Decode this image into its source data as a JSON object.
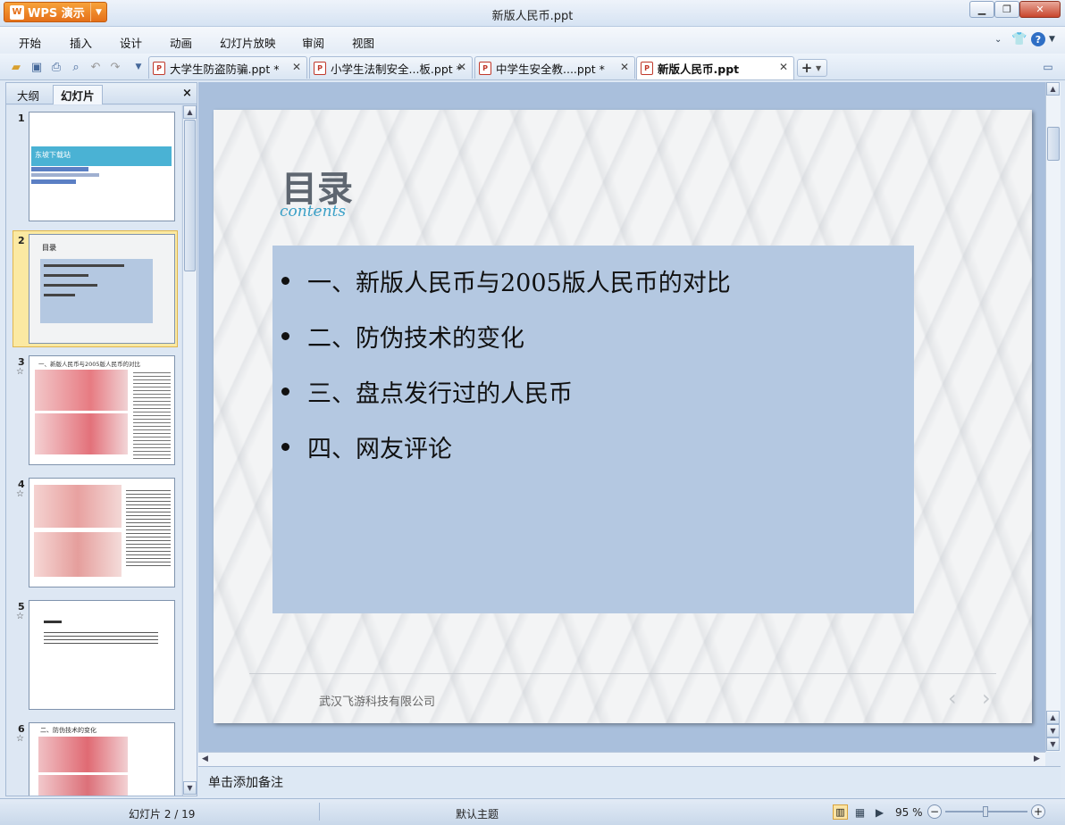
{
  "app": {
    "name": "WPS 演示",
    "window_title": "新版人民币.ppt"
  },
  "menu": [
    "开始",
    "插入",
    "设计",
    "动画",
    "幻灯片放映",
    "审阅",
    "视图"
  ],
  "tabs": [
    {
      "label": "大学生防盗防骗.ppt *",
      "active": false
    },
    {
      "label": "小学生法制安全...板.ppt *",
      "active": false
    },
    {
      "label": "中学生安全教....ppt *",
      "active": false
    },
    {
      "label": "新版人民币.ppt",
      "active": true
    }
  ],
  "panel": {
    "tab_outline": "大纲",
    "tab_slides": "幻灯片",
    "close": "×"
  },
  "thumbnails": [
    {
      "num": "1",
      "text": "东坡下载站",
      "star": ""
    },
    {
      "num": "2",
      "text": "目录",
      "star": ""
    },
    {
      "num": "3",
      "text": "一、新版人民币与2005版人民币的对比",
      "star": "☆"
    },
    {
      "num": "4",
      "text": "",
      "star": "☆"
    },
    {
      "num": "5",
      "text": "",
      "star": "☆"
    },
    {
      "num": "6",
      "text": "二、防伪技术的变化",
      "star": "☆"
    }
  ],
  "slide": {
    "title": "目录",
    "subtitle": "contents",
    "bullets": [
      "一、新版人民币与2005版人民币的对比",
      "二、防伪技术的变化",
      "三、盘点发行过的人民币",
      "四、网友评论"
    ],
    "footer": "武汉飞游科技有限公司",
    "nav_prev": "‹",
    "nav_next": "›"
  },
  "notes_placeholder": "单击添加备注",
  "status": {
    "slide_index": "幻灯片 2 / 19",
    "theme": "默认主题",
    "zoom": "95 %"
  },
  "colors": {
    "accent_orange": "#e5701a",
    "slide_box": "#b4c8e1",
    "subtitle": "#3aa0c7",
    "panel": "#d4e0ef"
  }
}
